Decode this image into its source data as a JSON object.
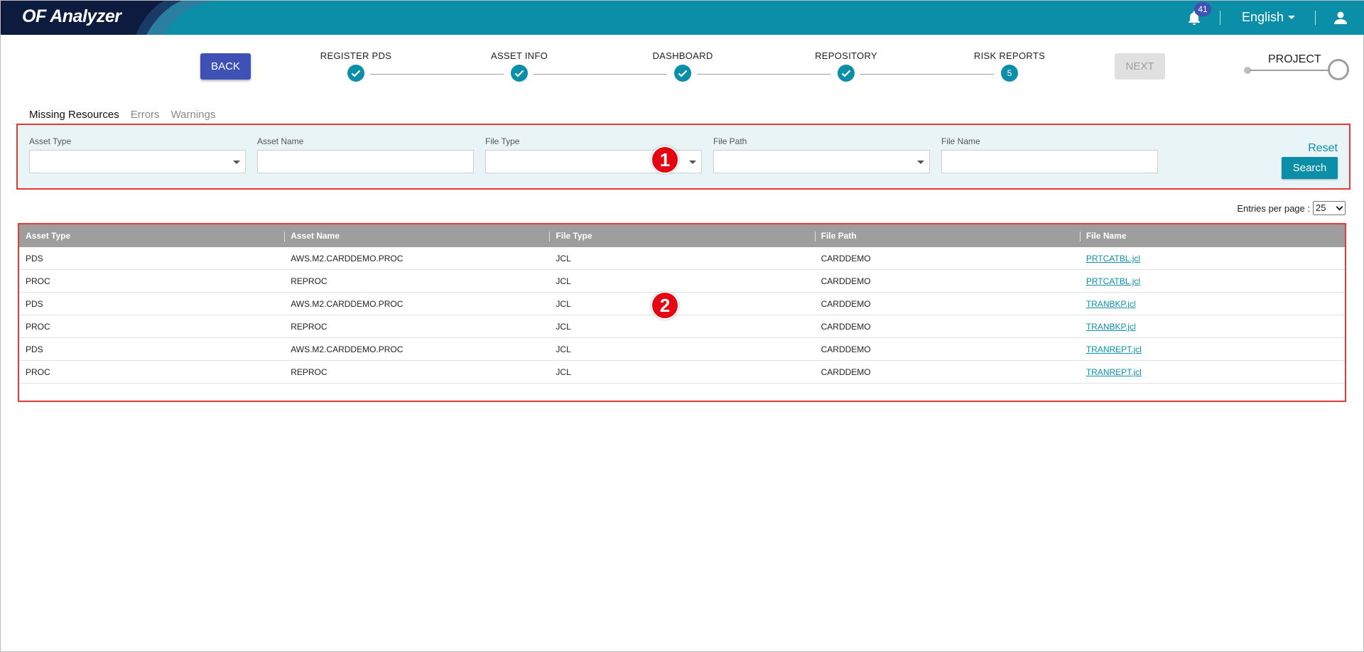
{
  "app": {
    "title": "OF Analyzer",
    "notification_count": "41",
    "language": "English"
  },
  "stepper": {
    "back_label": "BACK",
    "next_label": "NEXT",
    "steps": [
      {
        "label": "REGISTER PDS",
        "state": "done"
      },
      {
        "label": "ASSET INFO",
        "state": "done"
      },
      {
        "label": "DASHBOARD",
        "state": "done"
      },
      {
        "label": "REPOSITORY",
        "state": "done"
      },
      {
        "label": "RISK REPORTS",
        "state": "current",
        "number": "5"
      }
    ],
    "project_label": "PROJECT"
  },
  "tabs": [
    {
      "label": "Missing Resources",
      "active": true
    },
    {
      "label": "Errors",
      "active": false
    },
    {
      "label": "Warnings",
      "active": false
    }
  ],
  "filters": {
    "asset_type": {
      "label": "Asset Type",
      "value": ""
    },
    "asset_name": {
      "label": "Asset Name",
      "value": ""
    },
    "file_type": {
      "label": "File Type",
      "value": ""
    },
    "file_path": {
      "label": "File Path",
      "value": ""
    },
    "file_name": {
      "label": "File Name",
      "value": ""
    },
    "reset_label": "Reset",
    "search_label": "Search"
  },
  "markers": {
    "one": "1",
    "two": "2"
  },
  "entries": {
    "label": "Entries per page :",
    "value": "25"
  },
  "table": {
    "headers": [
      "Asset Type",
      "Asset Name",
      "File Type",
      "File Path",
      "File Name"
    ],
    "rows": [
      [
        "PDS",
        "AWS.M2.CARDDEMO.PROC",
        "JCL",
        "CARDDEMO",
        "PRTCATBL.jcl"
      ],
      [
        "PROC",
        "REPROC",
        "JCL",
        "CARDDEMO",
        "PRTCATBL.jcl"
      ],
      [
        "PDS",
        "AWS.M2.CARDDEMO.PROC",
        "JCL",
        "CARDDEMO",
        "TRANBKP.jcl"
      ],
      [
        "PROC",
        "REPROC",
        "JCL",
        "CARDDEMO",
        "TRANBKP.jcl"
      ],
      [
        "PDS",
        "AWS.M2.CARDDEMO.PROC",
        "JCL",
        "CARDDEMO",
        "TRANREPT.jcl"
      ],
      [
        "PROC",
        "REPROC",
        "JCL",
        "CARDDEMO",
        "TRANREPT.jcl"
      ]
    ]
  }
}
